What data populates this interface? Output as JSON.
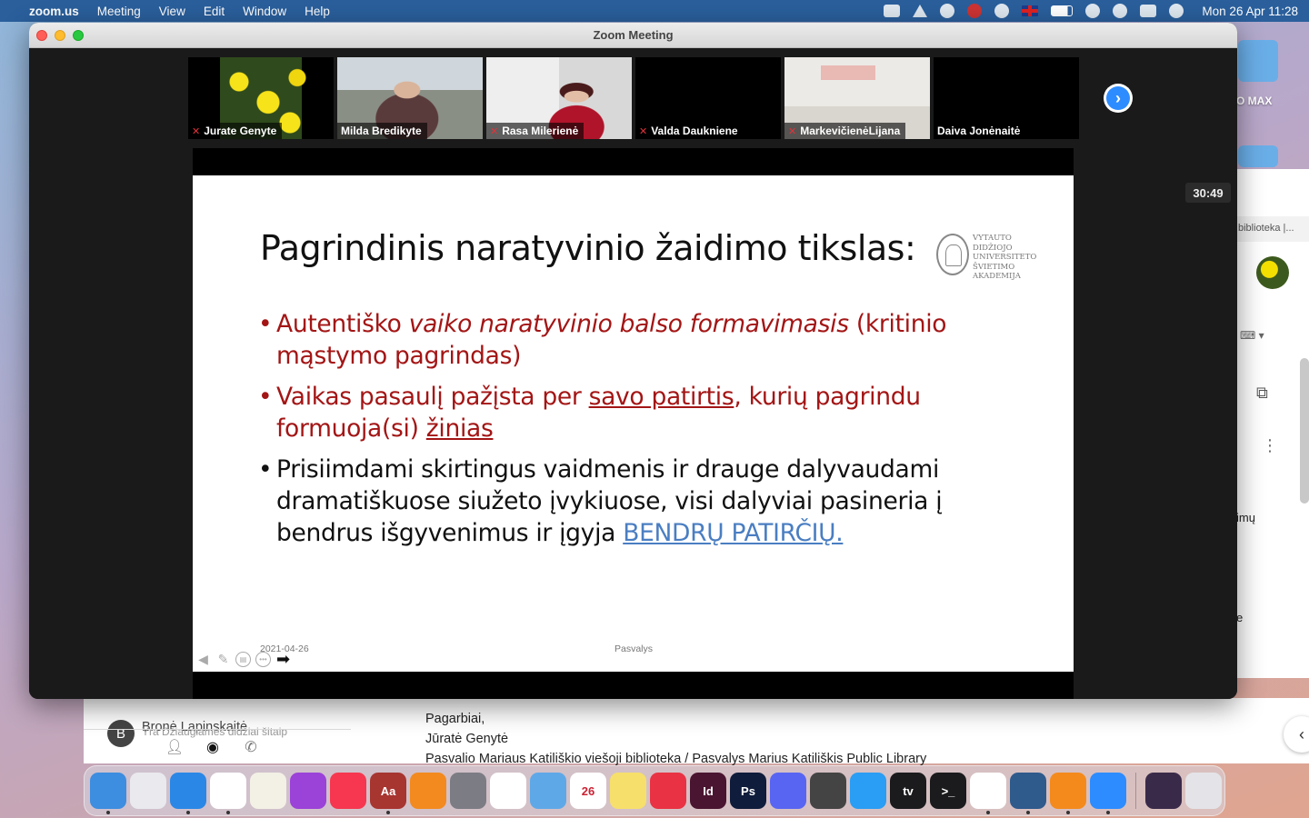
{
  "menubar": {
    "app": "zoom.us",
    "menus": [
      "Meeting",
      "View",
      "Edit",
      "Window",
      "Help"
    ],
    "clock": "Mon 26 Apr  11:28"
  },
  "window": {
    "title": "Zoom Meeting",
    "timer": "30:49"
  },
  "participants": [
    {
      "name": "Jurate Genyte",
      "muted": true,
      "video": "flowers"
    },
    {
      "name": "Milda Bredikyte",
      "muted": false,
      "video": "milda",
      "active": true
    },
    {
      "name": "Rasa Milerienė",
      "muted": true,
      "video": "rasa"
    },
    {
      "name": "Valda Daukniene",
      "muted": true,
      "video": "black"
    },
    {
      "name": "MarkevičienėLijana",
      "muted": true,
      "video": "office"
    },
    {
      "name": "Daiva Jonėnaitė",
      "muted": false,
      "video": "black"
    }
  ],
  "slide": {
    "title": "Pagrindinis naratyvinio žaidimo tikslas:",
    "logo_lines": [
      "VYTAUTO DIDŽIOJO",
      "UNIVERSITETO",
      "ŠVIETIMO",
      "AKADEMIJA"
    ],
    "bullet1": {
      "a": "Autentiško ",
      "b": "vaiko naratyvinio balso formavimasis",
      "c": " (kritinio mąstymo pagrindas)"
    },
    "bullet2": {
      "a": "Vaikas pasaulį pažįsta per ",
      "b": "savo patirtis",
      "c": ", kurių pagrindu formuoja(si) ",
      "d": "žinias"
    },
    "bullet3": {
      "a": "Prisiimdami skirtingus vaidmenis ir drauge dalyvaudami dramatiškuose siužeto įvykiuose, visi dalyviai pasineria į bendrus išgyvenimus ir įgyja ",
      "b": "BENDRŲ PATIRČIŲ."
    },
    "footer_date": "2021-04-26",
    "footer_place": "Pasvalys"
  },
  "background_app": {
    "contact_initial": "B",
    "contact_name": "Bronė Lapinskaitė",
    "contact_snippet": "Yra Džiaugiamės didžiai šitaip",
    "mail_lines": [
      "Pagarbiai,",
      "Jūratė Genytė",
      "Pasvalio Mariaus Katiliškio viešoji biblioteka / Pasvalys Marius Katiliškis Public Library"
    ]
  },
  "right_window": {
    "tab": "biblioteka |...",
    "text1": "imų",
    "text2": "e"
  },
  "desktop": {
    "folder_label": "O MAX"
  },
  "dock": {
    "apps": [
      {
        "name": "Finder",
        "color": "#3d8de0",
        "label": "",
        "running": true
      },
      {
        "name": "Launchpad",
        "color": "#e9e9ee",
        "label": "",
        "running": false
      },
      {
        "name": "Safari",
        "color": "#2a87e6",
        "label": "",
        "running": true
      },
      {
        "name": "Chrome",
        "color": "#ffffff",
        "label": "",
        "running": true
      },
      {
        "name": "TextEdit",
        "color": "#f3f0e6",
        "label": "",
        "running": false
      },
      {
        "name": "Podcasts",
        "color": "#9b42d8",
        "label": "",
        "running": false
      },
      {
        "name": "Music",
        "color": "#f6374f",
        "label": "",
        "running": false
      },
      {
        "name": "Dictionary",
        "color": "#a73530",
        "label": "Aa",
        "running": true
      },
      {
        "name": "Books",
        "color": "#f28a1f",
        "label": "",
        "running": false
      },
      {
        "name": "System Preferences",
        "color": "#7c7c84",
        "label": "",
        "running": false
      },
      {
        "name": "Photos",
        "color": "#ffffff",
        "label": "",
        "running": false
      },
      {
        "name": "Pixelmator",
        "color": "#5fa8e8",
        "label": "",
        "running": false
      },
      {
        "name": "Calendar",
        "color": "#ffffff",
        "label": "26",
        "running": false
      },
      {
        "name": "Notes",
        "color": "#f7df6b",
        "label": "",
        "running": false
      },
      {
        "name": "Speedtest",
        "color": "#e93243",
        "label": "",
        "running": false
      },
      {
        "name": "InDesign",
        "color": "#4a1530",
        "label": "Id",
        "running": false
      },
      {
        "name": "Photoshop",
        "color": "#0f1c3b",
        "label": "Ps",
        "running": false
      },
      {
        "name": "Discord",
        "color": "#5865f2",
        "label": "",
        "running": false
      },
      {
        "name": "Checker",
        "color": "#444444",
        "label": "",
        "running": false
      },
      {
        "name": "App Store",
        "color": "#2a9df4",
        "label": "",
        "running": false
      },
      {
        "name": "Apple TV",
        "color": "#1b1b1d",
        "label": "tv",
        "running": false
      },
      {
        "name": "Terminal",
        "color": "#1b1b1d",
        "label": ">_",
        "running": false
      },
      {
        "name": "Chrome 2",
        "color": "#ffffff",
        "label": "",
        "running": true
      },
      {
        "name": "Window Manager",
        "color": "#2f5a8c",
        "label": "",
        "running": true
      },
      {
        "name": "VLC",
        "color": "#f48a1c",
        "label": "",
        "running": true
      },
      {
        "name": "Zoom",
        "color": "#2d8cff",
        "label": "",
        "running": true
      },
      {
        "name": "Recent Item",
        "color": "#3a2a4a",
        "label": "",
        "running": false
      },
      {
        "name": "Trash",
        "color": "#e4e4e8",
        "label": "",
        "running": false
      }
    ]
  }
}
